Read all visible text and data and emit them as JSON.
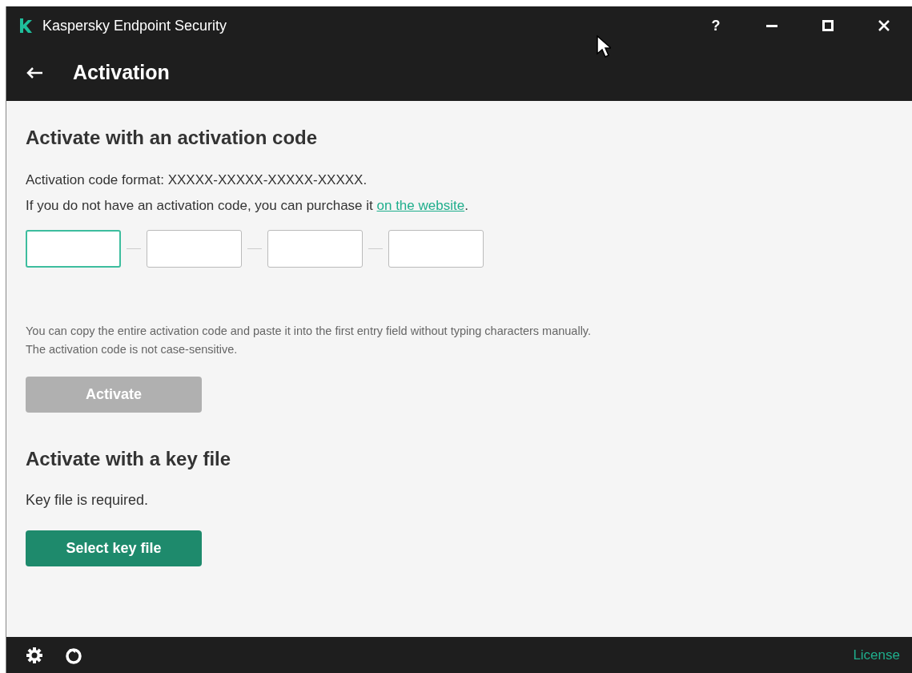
{
  "window": {
    "title": "Kaspersky Endpoint Security",
    "controls": [
      "?"
    ]
  },
  "header": {
    "title": "Activation"
  },
  "code_section": {
    "heading": "Activate with an activation code",
    "format_line": "Activation code format: XXXXX-XXXXX-XXXXX-XXXXX.",
    "purchase_text": "If you do not have an activation code, you can purchase it ",
    "purchase_link": "on the website",
    "purchase_end": ".",
    "fields": [
      {
        "focused": true
      },
      {
        "focused": false
      },
      {
        "focused": false
      },
      {
        "focused": false
      }
    ],
    "hint_lines": [
      "You can copy the entire activation code and paste it into the first entry field without typing characters manually.",
      "The activation code is not case-sensitive."
    ],
    "button": {
      "label": "Activate",
      "disabled": true
    }
  },
  "key_section": {
    "heading": "Activate with a key file",
    "note": "Key file is required.",
    "button": {
      "label": "Select key file",
      "disabled": false
    }
  },
  "status_bar": {
    "link": "License"
  }
}
